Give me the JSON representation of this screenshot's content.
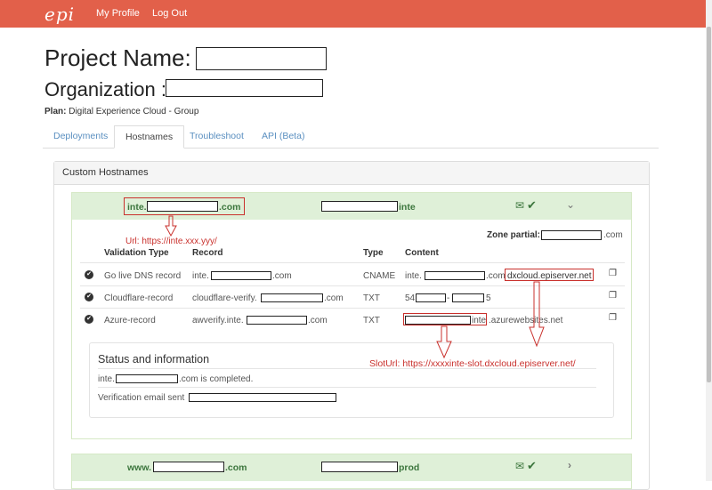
{
  "nav": {
    "logo": "epi",
    "links": [
      "My Profile",
      "Log Out"
    ]
  },
  "header": {
    "project_label": "Project Name:",
    "org_label": "Organization :",
    "plan_label": "Plan:",
    "plan_value": "Digital Experience Cloud - Group"
  },
  "tabs": [
    {
      "label": "Deployments",
      "active": false
    },
    {
      "label": "Hostnames",
      "active": true
    },
    {
      "label": "Troubleshoot",
      "active": false
    },
    {
      "label": "API (Beta)",
      "active": false
    }
  ],
  "panel": {
    "title": "Custom Hostnames"
  },
  "host1": {
    "prefix": "inte.",
    "suffix": ".com",
    "env": "inte",
    "zone_label": "Zone partial:",
    "zone_suffix": ".com",
    "annotation_url": "Url: https://inte.xxx.yyy/",
    "columns": [
      "Validation Type",
      "Record",
      "Type",
      "Content"
    ],
    "rows": [
      {
        "validation": "Go live DNS record",
        "record_prefix": "inte.",
        "record_suffix": ".com",
        "type": "CNAME",
        "content_prefix": "inte.",
        "content_mid": ".com",
        "content_box": "dxcloud.episerver.net"
      },
      {
        "validation": "Cloudflare-record",
        "record_prefix": "cloudflare-verify.",
        "record_suffix": ".com",
        "type": "TXT",
        "content_prefix": "54",
        "content_mid": "-",
        "content_suffix": "5"
      },
      {
        "validation": "Azure-record",
        "record_prefix": "awverify.inte.",
        "record_suffix": ".com",
        "type": "TXT",
        "content_prefix": "",
        "content_mid": "inte",
        "content_suffix": ".azurewebsites.net"
      }
    ],
    "status": {
      "title": "Status and information",
      "line1_prefix": "inte.",
      "line1_suffix": ".com is completed.",
      "line2": "Verification email sent"
    },
    "annotation_slot": "SlotUrl: https://xxxxinte-slot.dxcloud.episerver.net/"
  },
  "host2": {
    "prefix": "www.",
    "suffix": ".com",
    "env": "prod"
  },
  "icons": {
    "mail": "envelope-icon",
    "check": "check-icon",
    "chevron_down": "chevron-down-icon",
    "chevron_right": "chevron-right-icon",
    "copy": "copy-icon"
  },
  "colors": {
    "navbar": "#e2604a",
    "success_bg": "#dff0d8",
    "success_text": "#3c763d",
    "annotation": "#c9302c",
    "link": "#5a8fc0"
  }
}
